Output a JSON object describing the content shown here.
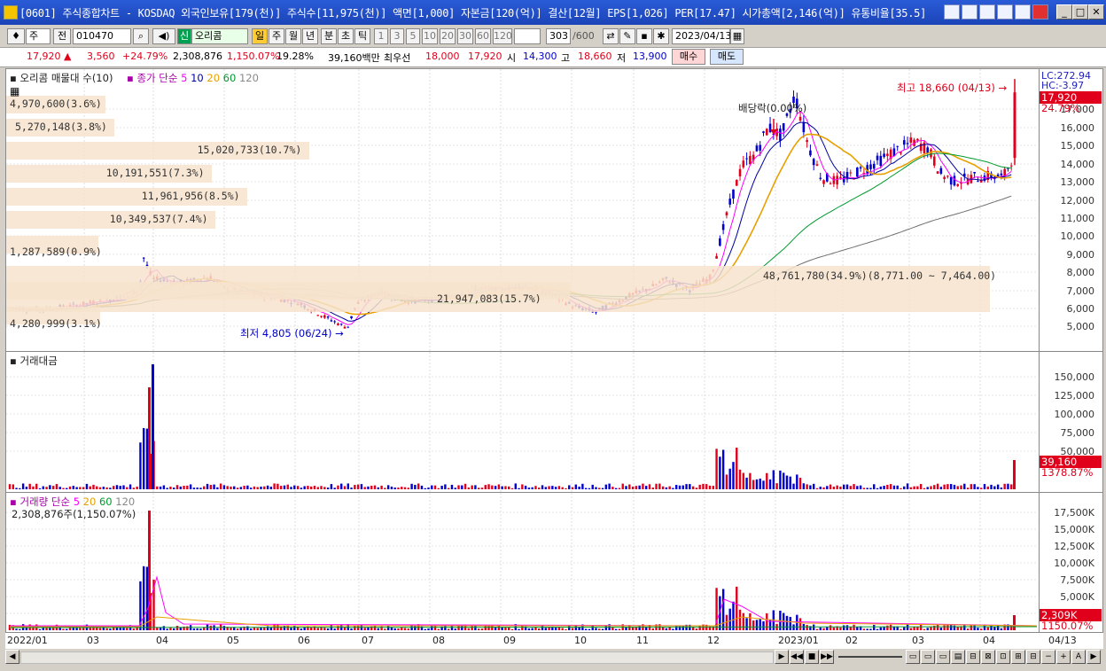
{
  "window": {
    "title": "[0601] 주식종합차트 - KOSDAQ 외국인보유[179(천)] 주식수[11,975(천)] 액면[1,000] 자본금[120(억)] 결산[12월] EPS[1,026] PER[17.47] 시가총액[2,146(억)] 유통비율[35.5]"
  },
  "toolbar": {
    "market": "주",
    "prev_label": "전",
    "code": "010470",
    "badge": "신",
    "name": "오리콤",
    "periods": [
      "일",
      "주",
      "월",
      "년",
      "분",
      "초",
      "틱"
    ],
    "intervals": [
      "1",
      "3",
      "5",
      "10",
      "20",
      "30",
      "60",
      "120"
    ],
    "count": "303",
    "count_total": "/600",
    "date": "2023/04/13"
  },
  "quote": {
    "price": "17,920",
    "up": "▲",
    "change": "3,560",
    "rate": "+24.79%",
    "volume": "2,308,876",
    "vol_rate": "1,150.07%",
    "turnover": "19.28%",
    "amount": "39,160백만",
    "best_label": "최우선",
    "best_ask": "18,000",
    "best_bid": "17,920",
    "open_label": "시",
    "open": "14,300",
    "high_label": "고",
    "high": "18,660",
    "low_label": "저",
    "low": "13,900",
    "buy": "매수",
    "sell": "매도"
  },
  "price_panel": {
    "header": "오리콤 매물대 수(10)",
    "ma_header": "종가 단순",
    "ma_periods": [
      "5",
      "10",
      "20",
      "60",
      "120"
    ],
    "lc": "LC:272.94",
    "hc": "HC:-3.97",
    "last_price": "17,920",
    "last_rate": "24.79%",
    "high_note": "최고 18,660 (04/13)",
    "low_note": "최저 4,805 (06/24)",
    "dividend_note": "배당락(0.00%)",
    "volume_profile": [
      "4,970,600(3.6%)",
      "5,270,148(3.8%)",
      "15,020,733(10.7%)",
      "10,191,551(7.3%)",
      "11,961,956(8.5%)",
      "10,349,537(7.4%)",
      "1,287,589(0.9%)",
      "48,761,780(34.9%)(8,771.00 ~ 7,464.00)",
      "21,947,083(15.7%)",
      "4,280,999(3.1%)"
    ],
    "ticks": [
      "17,000",
      "16,000",
      "15,000",
      "14,000",
      "13,000",
      "12,000",
      "11,000",
      "10,000",
      "9,000",
      "8,000",
      "7,000",
      "6,000",
      "5,000"
    ]
  },
  "amount_panel": {
    "title": "거래대금",
    "last": "39,160",
    "last_rate": "1378.87%",
    "ticks": [
      "150,000",
      "125,000",
      "100,000",
      "75,000",
      "50,000"
    ]
  },
  "volume_panel": {
    "title": "거래량",
    "ma_label": "단순",
    "ma_periods": [
      "5",
      "20",
      "60",
      "120"
    ],
    "info": "2,308,876주(1,150.07%)",
    "last": "2,309K",
    "last_rate": "1150.07%",
    "ticks": [
      "17,500K",
      "15,000K",
      "12,500K",
      "10,000K",
      "7,500K",
      "5,000K",
      "2,500K"
    ]
  },
  "x_axis": [
    "2022/01",
    "03",
    "04",
    "05",
    "06",
    "07",
    "08",
    "09",
    "10",
    "11",
    "12",
    "2023/01",
    "02",
    "03",
    "04"
  ],
  "x_axis_end": "04/13",
  "colors": {
    "up": "#e0001b",
    "down": "#0000d0",
    "ma5": "#ff00ff",
    "ma10": "#0000a0",
    "ma20": "#e8a000",
    "ma60": "#009a2e",
    "ma120": "#808080",
    "profile": "#f5dcc0"
  }
}
